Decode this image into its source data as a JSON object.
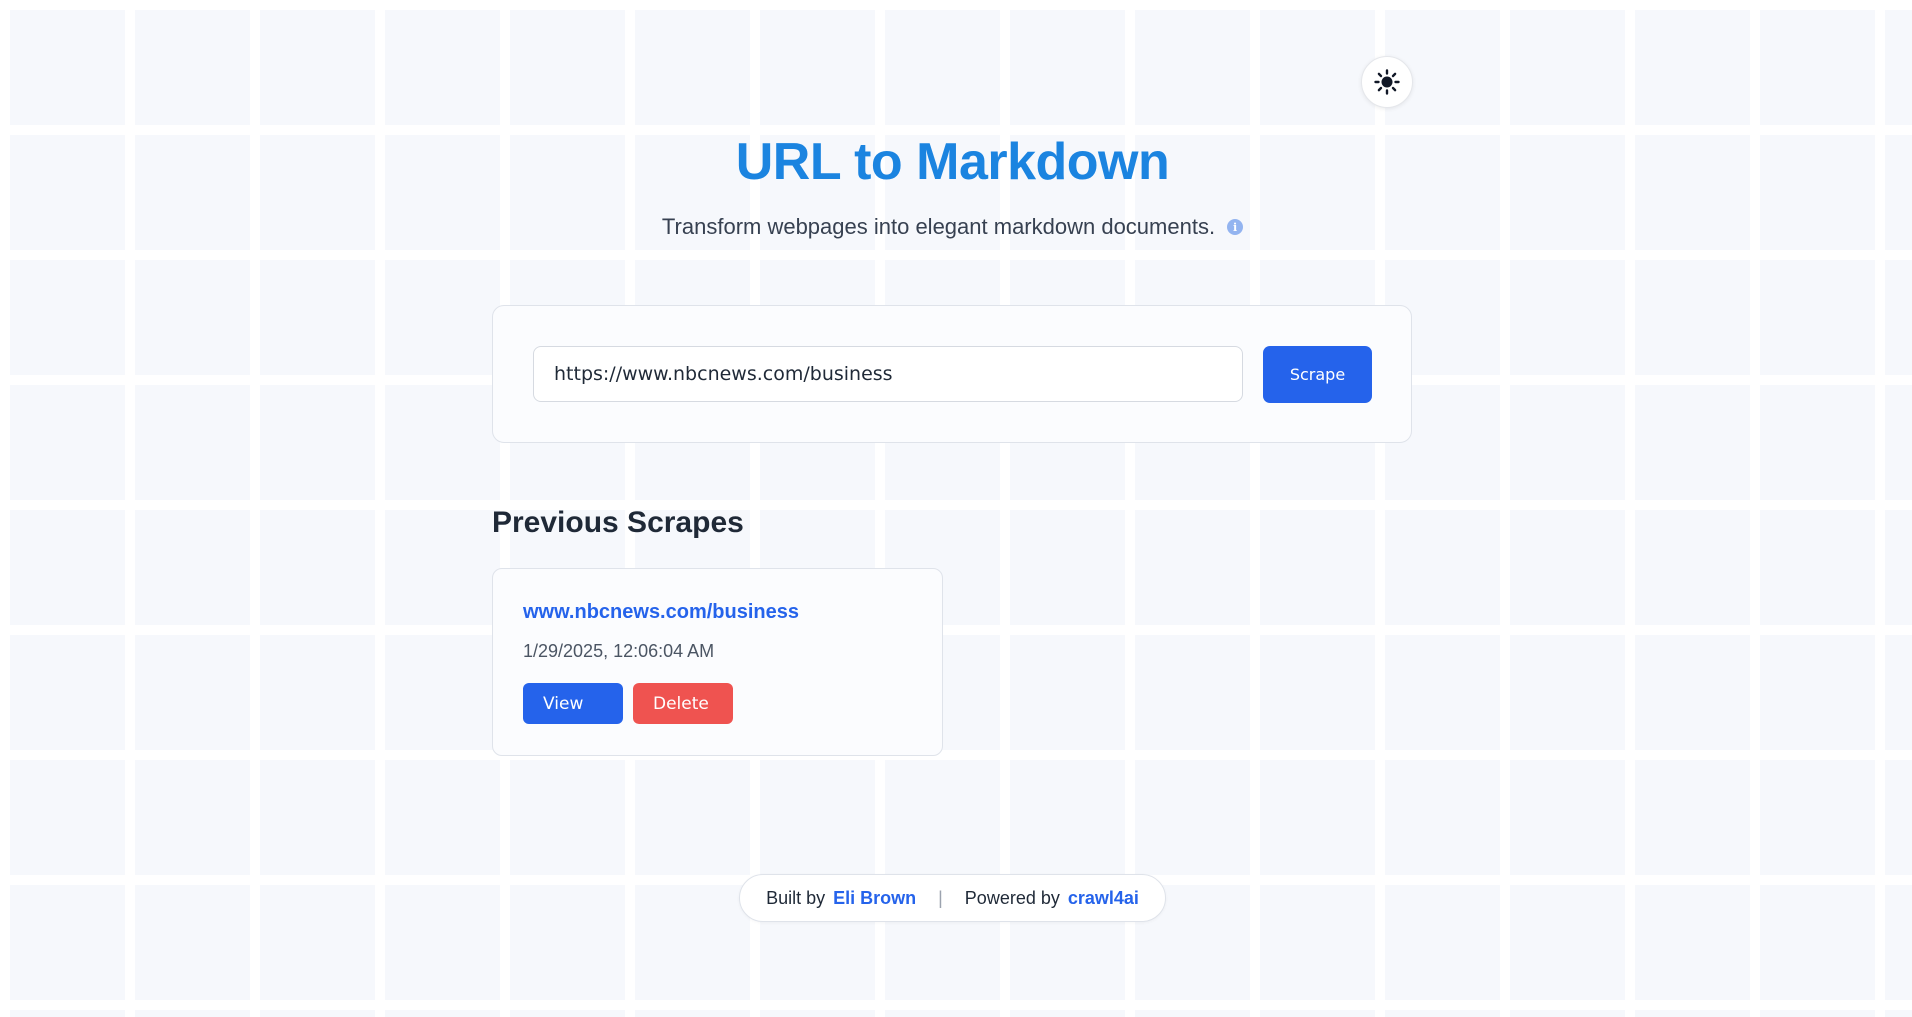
{
  "theme_toggle": {
    "icon": "sun-icon"
  },
  "header": {
    "title": "URL to Markdown",
    "subtitle": "Transform webpages into elegant markdown documents.",
    "info_icon": "i"
  },
  "scrape_form": {
    "url_value": "https://www.nbcnews.com/business",
    "button_label": "Scrape"
  },
  "history": {
    "heading": "Previous Scrapes",
    "items": [
      {
        "url": "www.nbcnews.com/business",
        "timestamp": "1/29/2025, 12:06:04 AM",
        "view_label": "View",
        "delete_label": "Delete"
      }
    ]
  },
  "footer": {
    "built_by_label": "Built by",
    "author": "Eli Brown",
    "separator": "|",
    "powered_by_label": "Powered by",
    "powered_by_name": "crawl4ai"
  },
  "colors": {
    "title_blue": "#1b84e0",
    "primary": "#2563eb",
    "danger": "#ef5350"
  }
}
